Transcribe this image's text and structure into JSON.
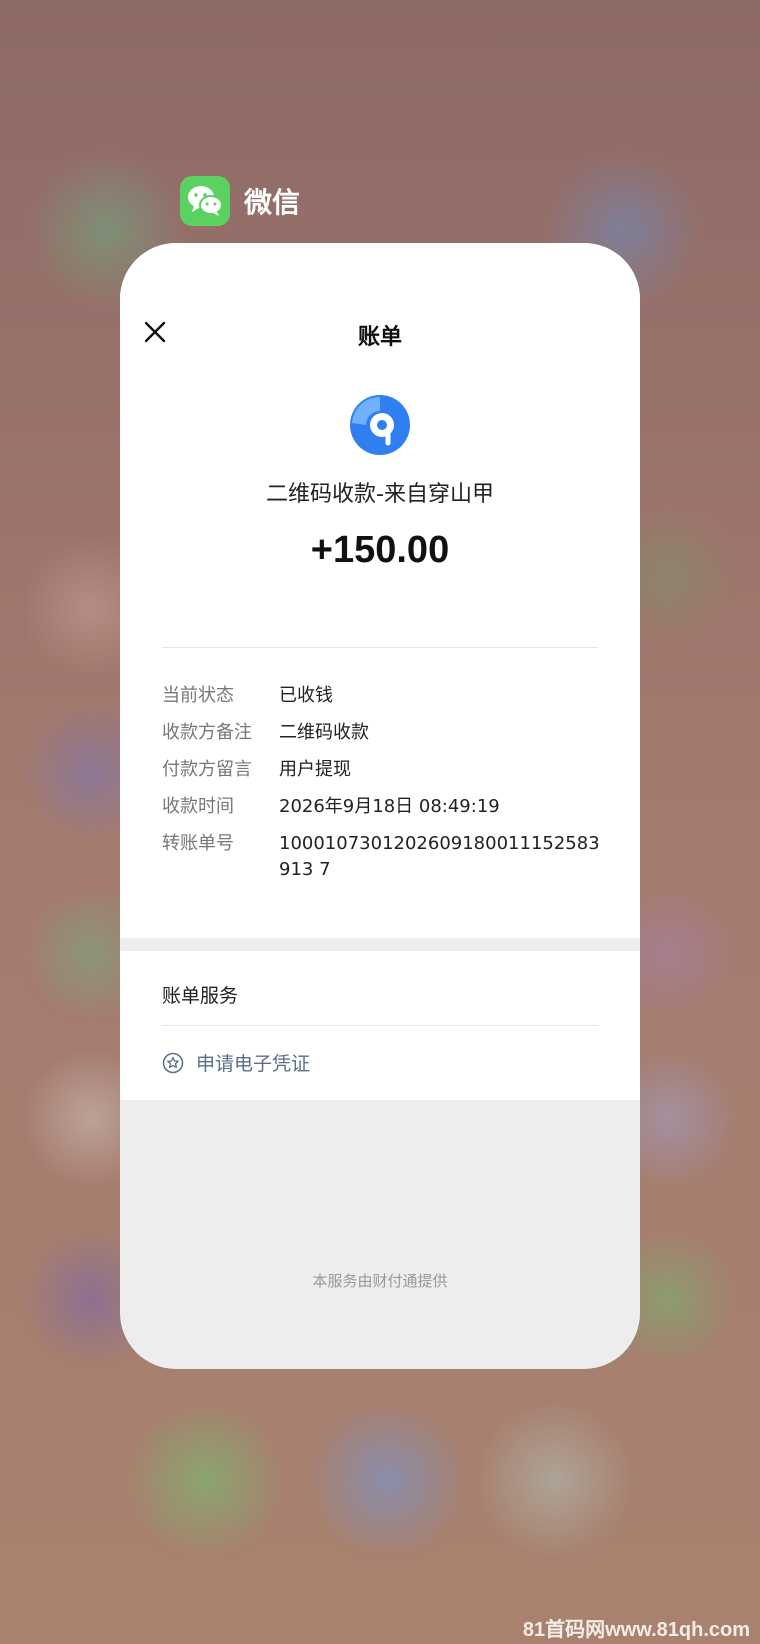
{
  "app": {
    "name": "微信",
    "accent": "#5bd15f"
  },
  "bill": {
    "title": "账单",
    "merchant": "二维码收款-来自穿山甲",
    "amount": "+150.00",
    "details": [
      {
        "label": "当前状态",
        "value": "已收钱"
      },
      {
        "label": "收款方备注",
        "value": "二维码收款"
      },
      {
        "label": "付款方留言",
        "value": "用户提现"
      },
      {
        "label": "收款时间",
        "value": "2026年9月18日 08:49:19"
      },
      {
        "label": "转账单号",
        "value": "1000107301202609180011152583913 7"
      }
    ]
  },
  "services": {
    "title": "账单服务",
    "voucher_label": "申请电子凭证"
  },
  "footer": "本服务由财付通提供",
  "watermark": "81首码网www.81qh.com"
}
